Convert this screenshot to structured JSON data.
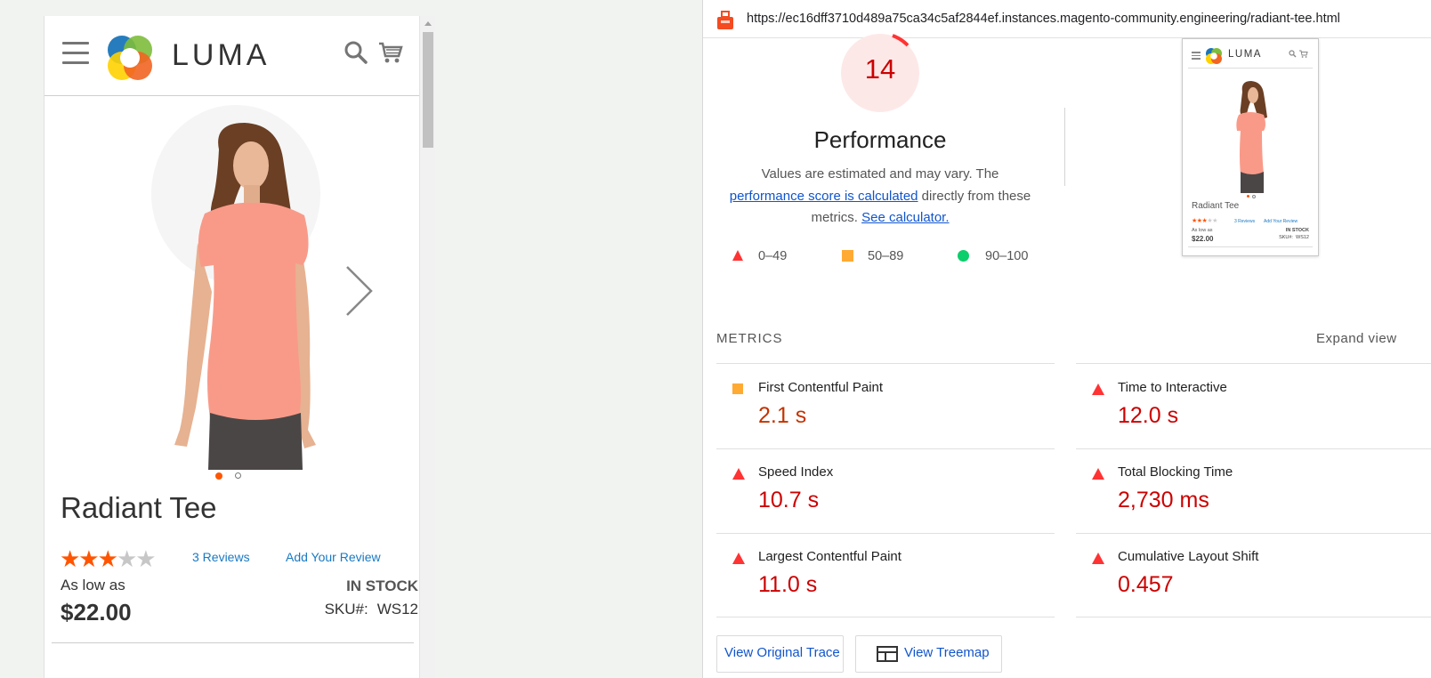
{
  "mobile_page": {
    "logo_text": "LUMA",
    "product_title": "Radiant Tee",
    "rating": 3,
    "rating_max": 5,
    "reviews_link": "3  Reviews",
    "add_review_link": "Add Your Review",
    "as_low_as": "As low as",
    "price": "$22.00",
    "stock_status": "IN STOCK",
    "sku_label": "SKU#:",
    "sku_value": "WS12",
    "gallery_images": 2,
    "gallery_active": 1,
    "colors": {
      "accent": "#ff5501",
      "link": "#1979c3"
    }
  },
  "report": {
    "url": "https://ec16dff3710d489a75ca34c5af2844ef.instances.magento-community.engineering/radiant-tee.html",
    "score": "14",
    "category_title": "Performance",
    "description": {
      "text1": "Values are estimated and may vary. The ",
      "link1": "performance score is calculated",
      "text2": " directly from these metrics. ",
      "link2": "See calculator."
    },
    "legend": [
      {
        "range": "0–49",
        "color": "#ff3333"
      },
      {
        "range": "50–89",
        "color": "#ffaa33"
      },
      {
        "range": "90–100",
        "color": "#0cce6b"
      }
    ],
    "thumbnail": {
      "logo": "LUMA",
      "title": "Radiant Tee",
      "reviews": "3  Reviews",
      "add_review": "Add Your Review",
      "as_low_as": "As low as",
      "price": "$22.00",
      "stock": "IN STOCK",
      "sku": "SKU#:  WS12"
    },
    "metrics_title": "METRICS",
    "expand_view": "Expand view",
    "metrics": [
      {
        "label": "First Contentful Paint",
        "value": "2.1 s",
        "rating": "average"
      },
      {
        "label": "Time to Interactive",
        "value": "12.0 s",
        "rating": "fail"
      },
      {
        "label": "Speed Index",
        "value": "10.7 s",
        "rating": "fail"
      },
      {
        "label": "Total Blocking Time",
        "value": "2,730 ms",
        "rating": "fail"
      },
      {
        "label": "Largest Contentful Paint",
        "value": "11.0 s",
        "rating": "fail"
      },
      {
        "label": "Cumulative Layout Shift",
        "value": "0.457",
        "rating": "fail"
      }
    ],
    "buttons": {
      "view_trace": "View Original Trace",
      "view_treemap": "View Treemap"
    },
    "colors": {
      "fail": "#cc0000",
      "average": "#c33300",
      "link": "#1155cc"
    }
  }
}
